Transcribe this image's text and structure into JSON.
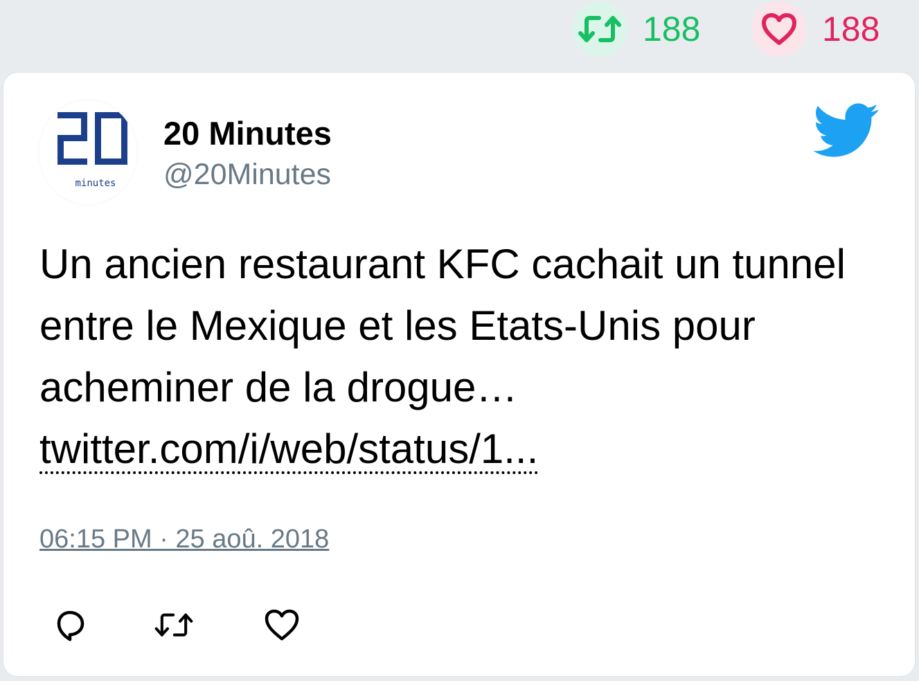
{
  "stats": {
    "retweet_count": "188",
    "like_count": "188"
  },
  "author": {
    "name": "20 Minutes",
    "handle": "@20Minutes",
    "avatar_logo": "20",
    "avatar_sub": "minutes"
  },
  "tweet": {
    "text": "Un ancien restaurant KFC cachait un tunnel entre le Mexique et les Etats-Unis pour acheminer de la drogue…",
    "link": "twitter.com/i/web/status/1...",
    "timestamp": "06:15 PM · 25 aoû. 2018"
  },
  "icons": {
    "retweet": "retweet-icon",
    "like": "heart-icon",
    "reply": "reply-icon",
    "brand": "twitter-bird-icon"
  },
  "colors": {
    "retweet_green": "#17bf63",
    "like_red": "#e0245e",
    "twitter_blue": "#1da1f2",
    "avatar_blue": "#1c3f8c",
    "muted_text": "#687987"
  }
}
